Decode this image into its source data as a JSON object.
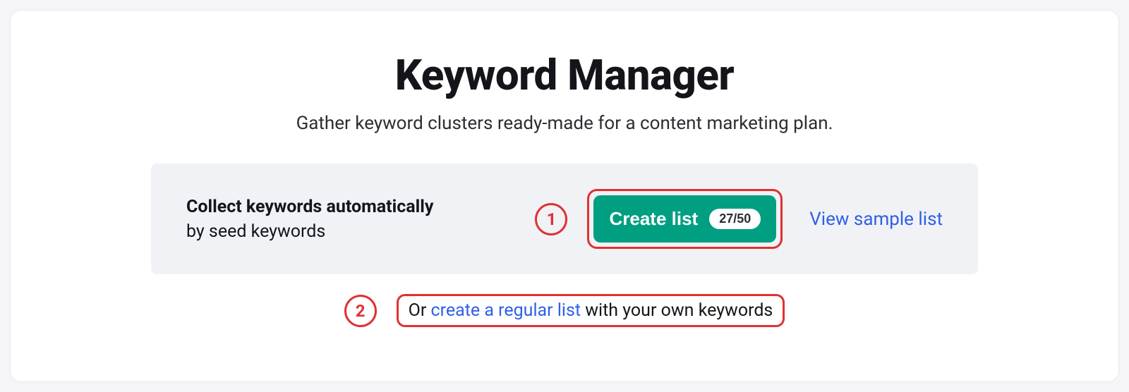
{
  "header": {
    "title": "Keyword Manager",
    "subtitle": "Gather keyword clusters ready-made for a content marketing plan."
  },
  "panel": {
    "line1": "Collect keywords automatically",
    "line2": "by seed keywords",
    "create_label": "Create list",
    "quota": "27/50",
    "sample_link": "View sample list"
  },
  "alt": {
    "prefix": "Or ",
    "link": "create a regular list",
    "suffix": " with your own keywords"
  },
  "annotations": {
    "one": "1",
    "two": "2"
  }
}
